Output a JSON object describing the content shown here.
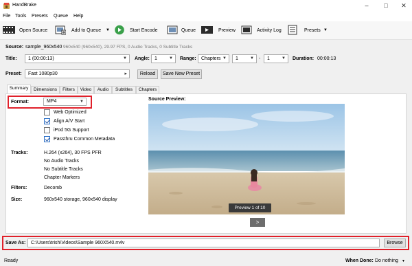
{
  "app": {
    "title": "HandBrake"
  },
  "menu": [
    "File",
    "Tools",
    "Presets",
    "Queue",
    "Help"
  ],
  "toolbar": {
    "open_source": "Open Source",
    "add_to_queue": "Add to Queue",
    "start_encode": "Start Encode",
    "queue": "Queue",
    "preview": "Preview",
    "activity_log": "Activity Log",
    "presets": "Presets"
  },
  "source": {
    "label": "Source:",
    "name": "sample_960x540",
    "details": "960x540 (960x540), 29.97 FPS, 0 Audio Tracks, 0 Subtitle Tracks"
  },
  "title_row": {
    "title_label": "Title:",
    "title_value": "1 (00:00:13)",
    "angle_label": "Angle:",
    "angle_value": "1",
    "range_label": "Range:",
    "range_value": "Chapters",
    "range_start": "1",
    "range_sep": "-",
    "range_end": "1",
    "duration_label": "Duration:",
    "duration_value": "00:00:13"
  },
  "preset_row": {
    "label": "Preset:",
    "value": "Fast 1080p30",
    "reload": "Reload",
    "save_new": "Save New Preset"
  },
  "tabs": [
    "Summary",
    "Dimensions",
    "Filters",
    "Video",
    "Audio",
    "Subtitles",
    "Chapters"
  ],
  "summary": {
    "format_label": "Format:",
    "format_value": "MP4",
    "options": [
      {
        "label": "Web Optimized",
        "checked": false
      },
      {
        "label": "Align A/V Start",
        "checked": true
      },
      {
        "label": "iPod 5G Support",
        "checked": false
      },
      {
        "label": "Passthru Common Metadata",
        "checked": true
      }
    ],
    "tracks_label": "Tracks:",
    "tracks": [
      "H.264 (x264), 30 FPS PFR",
      "No Audio Tracks",
      "No Subtitle Tracks",
      "Chapter Markers"
    ],
    "filters_label": "Filters:",
    "filters_value": "Decomb",
    "size_label": "Size:",
    "size_value": "960x540 storage, 960x540 display",
    "source_preview_label": "Source Preview:",
    "preview_badge": "Preview 1 of 10",
    "next": ">"
  },
  "save": {
    "label": "Save As:",
    "path": "C:\\Users\\trish\\Videos\\Sample 960X540.m4v",
    "browse": "Browse"
  },
  "status": {
    "ready": "Ready",
    "when_done_label": "When Done:",
    "when_done_value": "Do nothing"
  },
  "colors": {
    "highlight": "#e0202a",
    "play_green": "#3aa04a"
  }
}
